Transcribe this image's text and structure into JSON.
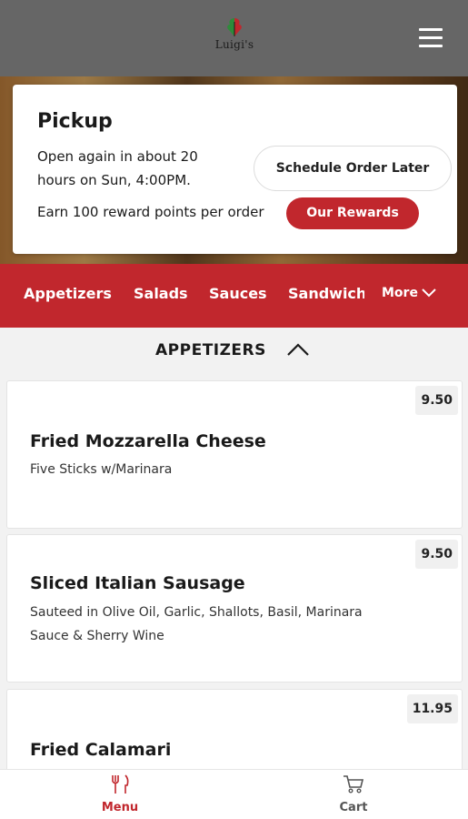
{
  "header": {
    "logo_text": "Luigi's",
    "menu_icon": "hamburger-menu-icon"
  },
  "pickup": {
    "title": "Pickup",
    "status": "Open again in about 20 hours on Sun, 4:00PM.",
    "schedule_label": "Schedule Order Later",
    "rewards_text": "Earn 100 reward points per order",
    "rewards_button": "Our Rewards"
  },
  "categories": {
    "items": [
      "Appetizers",
      "Salads",
      "Sauces",
      "Sandwiches"
    ],
    "more_label": "More"
  },
  "section": {
    "title": "APPETIZERS"
  },
  "menu_items": [
    {
      "name": "Fried Mozzarella Cheese",
      "description": "Five Sticks w/Marinara",
      "price": "9.50"
    },
    {
      "name": "Sliced Italian Sausage",
      "description": "Sauteed in Olive Oil, Garlic, Shallots, Basil, Marinara Sauce & Sherry Wine",
      "price": "9.50"
    },
    {
      "name": "Fried Calamari",
      "description": "",
      "price": "11.95"
    }
  ],
  "tabbar": {
    "menu_label": "Menu",
    "cart_label": "Cart"
  },
  "colors": {
    "brand_red": "#c1272d",
    "header_gray": "#666666"
  }
}
